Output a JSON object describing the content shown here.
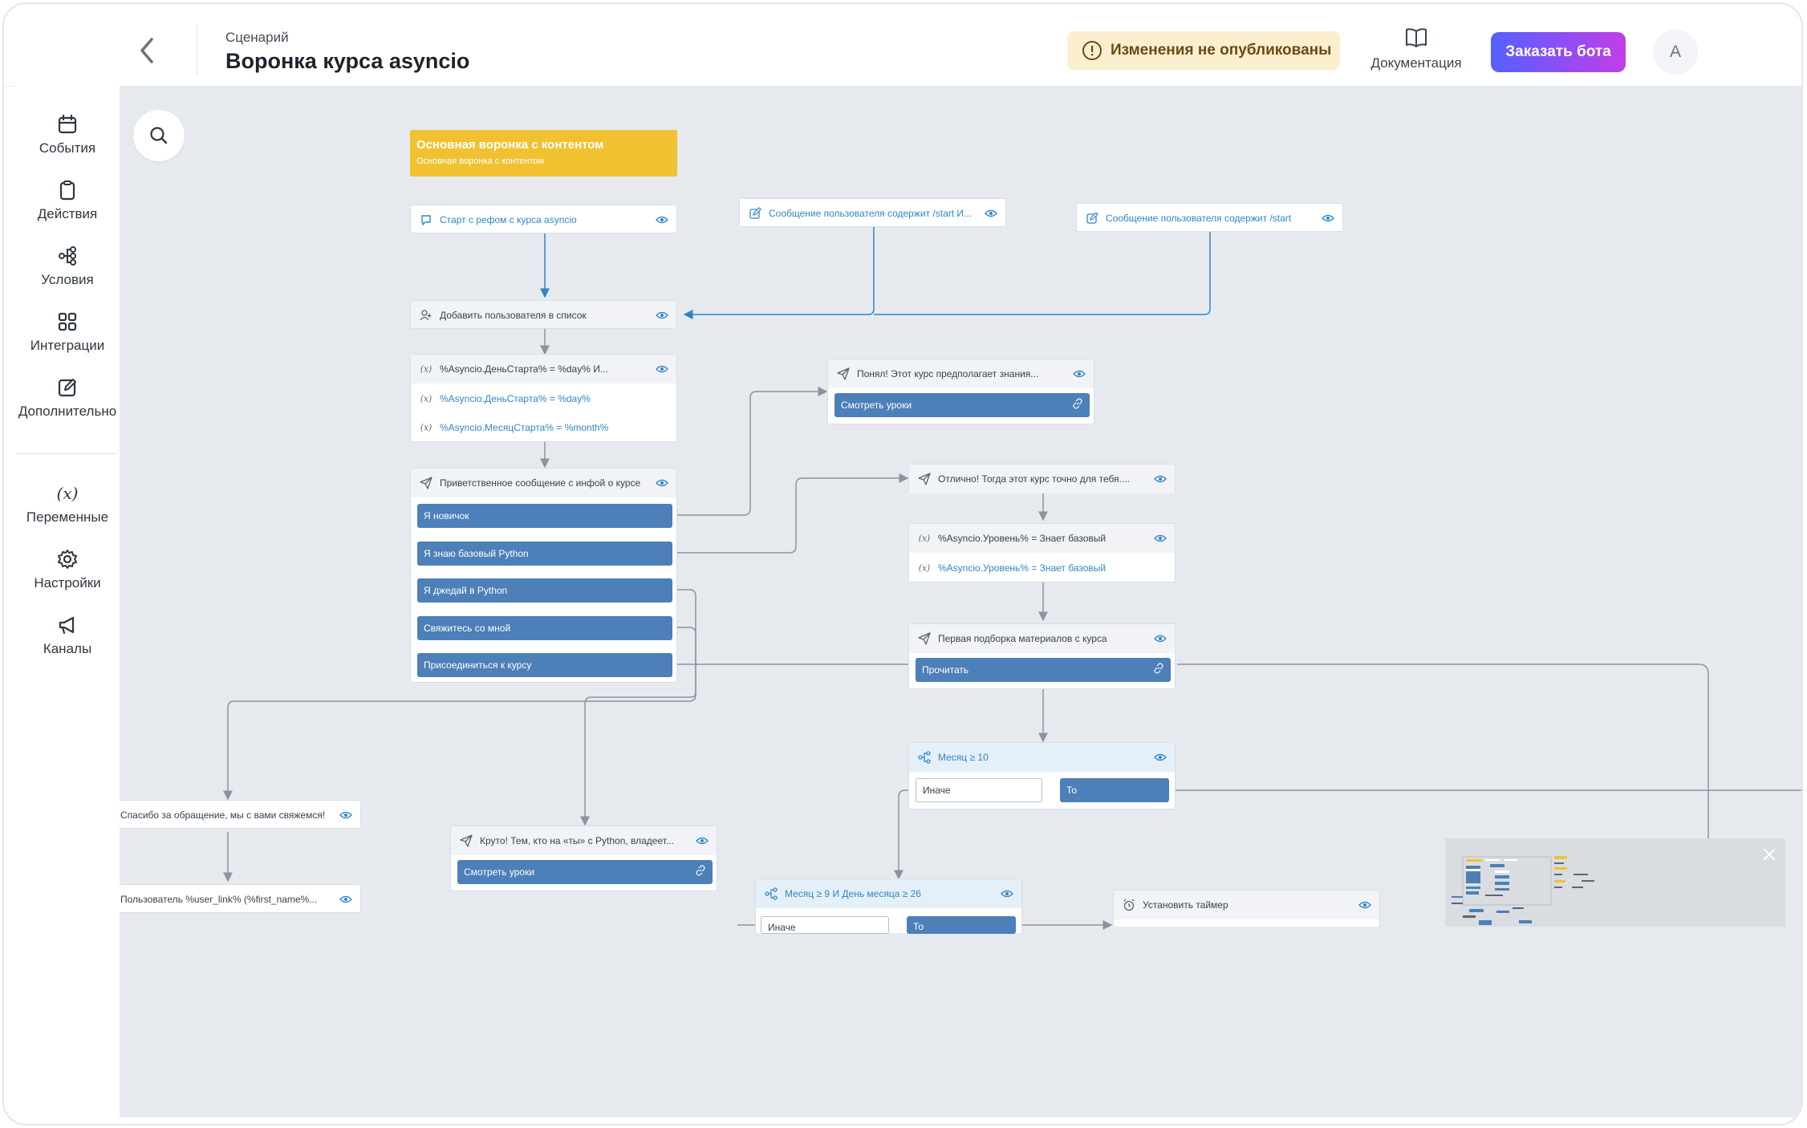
{
  "header": {
    "breadcrumb": "Сценарий",
    "title": "Воронка курса asyncio",
    "warning": "Изменения не опубликованы",
    "docs_label": "Документация",
    "order_button": "Заказать бота",
    "avatar_initial": "A"
  },
  "sidebar": {
    "items": [
      {
        "label": "События",
        "icon": "calendar-icon"
      },
      {
        "label": "Действия",
        "icon": "clipboard-icon"
      },
      {
        "label": "Условия",
        "icon": "branch-icon"
      },
      {
        "label": "Интеграции",
        "icon": "grid-icon"
      },
      {
        "label": "Дополнительно",
        "icon": "edit-icon"
      },
      {
        "label": "Переменные",
        "icon": "variable-icon"
      },
      {
        "label": "Настройки",
        "icon": "gear-icon"
      },
      {
        "label": "Каналы",
        "icon": "megaphone-icon"
      }
    ]
  },
  "canvas": {
    "group_title": "Основная воронка с контентом",
    "group_subtitle": "Основная воронка с контентом",
    "nodes": {
      "start": "Старт с рефом с курса asyncio",
      "trigger1": "Сообщение пользователя содержит /start И...",
      "trigger2": "Сообщение пользователя содержит /start",
      "add_list": "Добавить пользователя в список",
      "vars1": {
        "head": "%Asyncio.ДеньСтарта% = %day% И...",
        "row1": "%Asyncio.ДеньСтарта% = %day%",
        "row2": "%Asyncio.МесяцСтарта% = %month%"
      },
      "welcome": {
        "head": "Приветственное сообщение с инфой о курсе",
        "buttons": [
          "Я новичок",
          "Я знаю базовый Python",
          "Я джедай в Python",
          "Свяжитесь со мной",
          "Присоединиться к курсу"
        ]
      },
      "understood": {
        "head": "Понял! Этот курс предполагает знания...",
        "button": "Смотреть уроки"
      },
      "excellent": "Отлично! Тогда этот курс точно для тебя....",
      "vars2": {
        "head": "%Asyncio.Уровень% = Знает базовый",
        "row1": "%Asyncio.Уровень% = Знает базовый"
      },
      "first_pick": {
        "head": "Первая подборка материалов с курса",
        "button": "Прочитать"
      },
      "month10": {
        "head": "Месяц ≥ 10",
        "else": "Иначе",
        "then": "То"
      },
      "thanks": "Спасибо за обращение, мы с вами свяжемся!",
      "userlink": "Пользователь %user_link% (%first_name%...",
      "cool": {
        "head": "Круто! Тем, кто на «ты» с Python, владеет...",
        "button": "Смотреть уроки"
      },
      "month9": {
        "head": "Месяц ≥ 9 И День месяца ≥ 26",
        "else": "Иначе",
        "then": "То"
      },
      "timer": "Установить таймер"
    }
  },
  "colors": {
    "accent": "#4d7fb8",
    "link": "#2f86c6",
    "group": "#f0c232",
    "warning_bg": "#fbefd0",
    "gradient_start": "#5560ff",
    "gradient_end": "#c13ee8"
  }
}
